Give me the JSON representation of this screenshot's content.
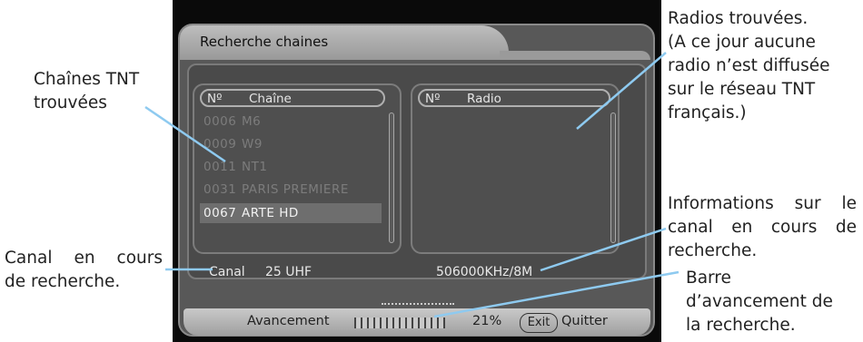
{
  "screen": {
    "title": "Recherche chaines",
    "channels_panel": {
      "header_number": "Nº",
      "header_name": "Chaîne",
      "rows": [
        {
          "number": "0006",
          "name": "M6"
        },
        {
          "number": "0009",
          "name": "W9"
        },
        {
          "number": "0011",
          "name": "NT1"
        },
        {
          "number": "0031",
          "name": "PARIS PREMIERE"
        },
        {
          "number": "0067",
          "name": "ARTE HD"
        }
      ],
      "selected_index": 4
    },
    "radio_panel": {
      "header_number": "Nº",
      "header_name": "Radio"
    },
    "canal_label": "Canal",
    "canal_value": "25 UHF",
    "frequency": "506000KHz/8M",
    "progress_label": "Avancement",
    "progress_percent": "21%",
    "progress_fraction": 0.21,
    "exit_key": "Exit",
    "exit_label": "Quitter"
  },
  "annotations": {
    "channels_found": [
      "Chaînes TNT",
      "trouvées"
    ],
    "canal": [
      "Canal en cours",
      "de recherche."
    ],
    "radios": [
      "Radios trouvées.",
      "(A ce jour aucune",
      "radio n’est diffusée",
      "sur le réseau TNT",
      "français.)"
    ],
    "channel_info": [
      "Informations sur le",
      "canal en cours de",
      "recherche."
    ],
    "progress_bar": [
      "Barre",
      "d’avancement de",
      "la recherche."
    ]
  },
  "colors": {
    "leader_line": "#8ecaf0",
    "selected_row": "#6e6e6e",
    "frame": "#585858"
  }
}
